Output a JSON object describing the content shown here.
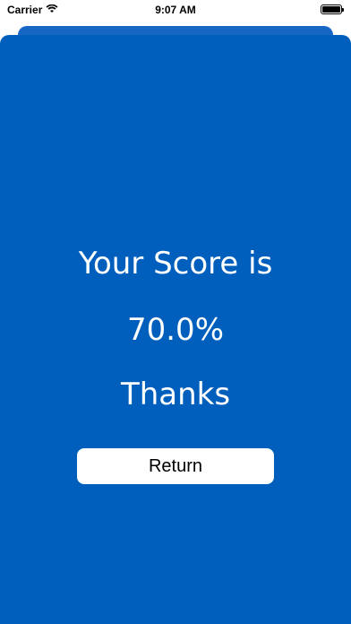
{
  "status_bar": {
    "carrier": "Carrier",
    "time": "9:07 AM",
    "icons": [
      "wifi-icon",
      "battery-icon"
    ]
  },
  "modal": {
    "title": "Your Score is",
    "score": "70.0%",
    "message": "Thanks",
    "return_label": "Return"
  },
  "colors": {
    "background": "#005fbd",
    "button": "#ffffff",
    "text": "#ffffff"
  }
}
